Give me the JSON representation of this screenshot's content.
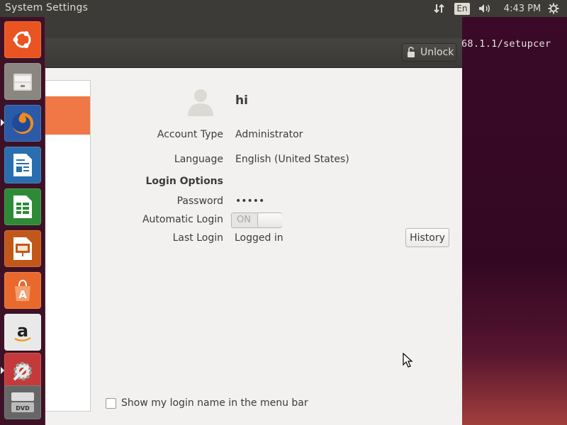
{
  "top_panel": {
    "app_title": "System Settings",
    "keyboard_layout": "En",
    "clock": "4:43 PM"
  },
  "desktop": {
    "terminal_text": "68.1.1/setupcer"
  },
  "launcher": {
    "items": [
      {
        "icon": "ubuntu-dash-icon",
        "color": "#e95420"
      },
      {
        "icon": "files-icon",
        "color": "#8a8680"
      },
      {
        "icon": "firefox-icon",
        "color": "#e66000",
        "running": true
      },
      {
        "icon": "libreoffice-writer-icon",
        "color": "#2a6eb0"
      },
      {
        "icon": "libreoffice-calc-icon",
        "color": "#2f8a37"
      },
      {
        "icon": "libreoffice-impress-icon",
        "color": "#c2571a"
      },
      {
        "icon": "software-center-icon",
        "color": "#e9692c"
      },
      {
        "icon": "amazon-icon",
        "color": "#555555"
      },
      {
        "icon": "system-settings-icon",
        "color": "#c43a3a",
        "running": true
      },
      {
        "icon": "dvd-drive-icon",
        "color": "#777777"
      }
    ]
  },
  "window": {
    "toolbar": {
      "unlock_label": "Unlock"
    },
    "user": {
      "name": "hi",
      "account_type_label": "Account Type",
      "account_type_value": "Administrator",
      "language_label": "Language",
      "language_value": "English (United States)",
      "login_options_heading": "Login Options",
      "password_label": "Password",
      "password_value": "•••••",
      "automatic_login_label": "Automatic Login",
      "automatic_login_state": "ON",
      "last_login_label": "Last Login",
      "last_login_value": "Logged in",
      "history_button": "History"
    },
    "show_login_name_label": "Show my login name in the menu bar",
    "show_login_name_checked": false
  },
  "colors": {
    "accent": "#f07746",
    "panel": "#3c3b37",
    "launcher": "#3d1226"
  }
}
